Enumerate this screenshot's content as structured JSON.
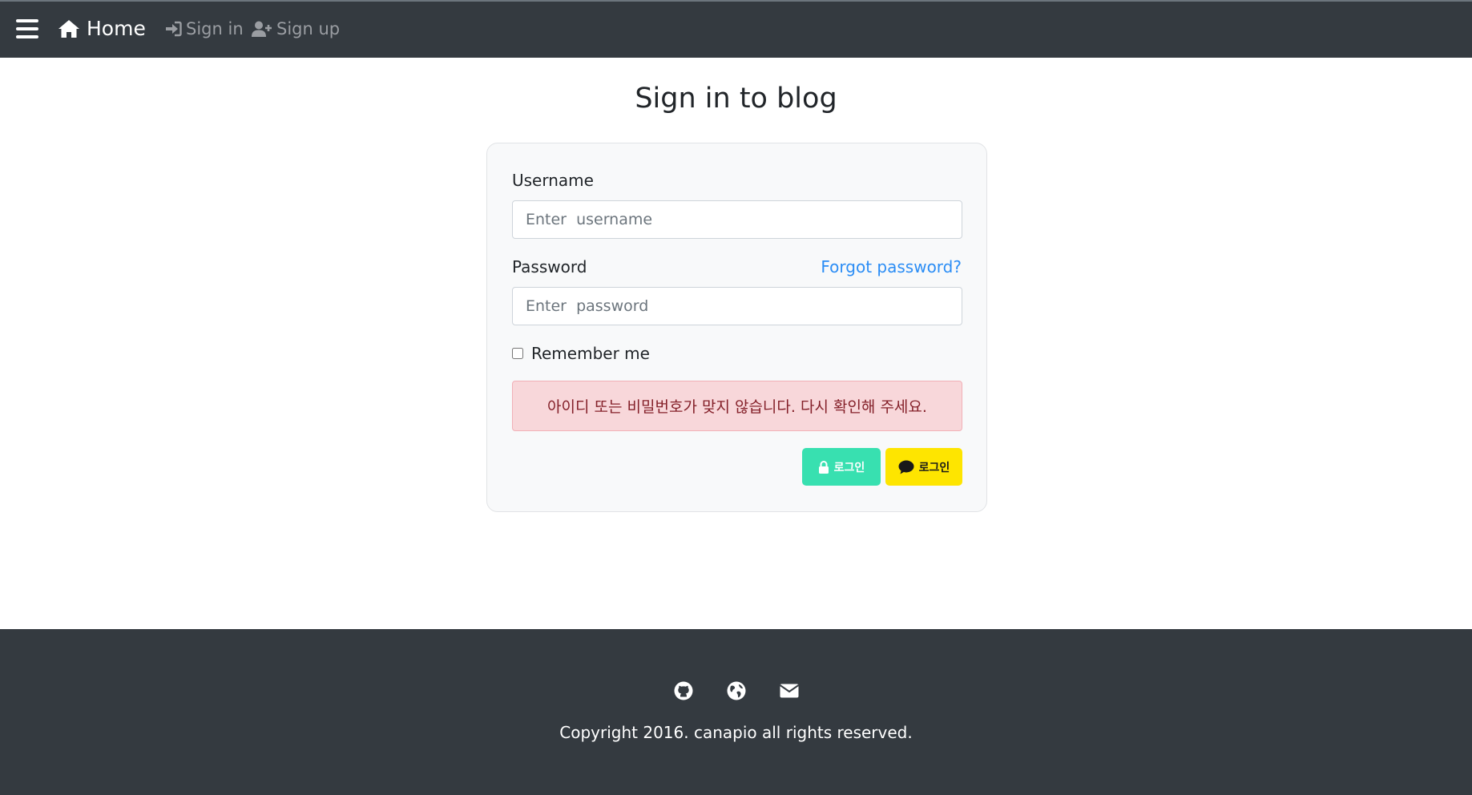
{
  "navbar": {
    "brand_label": "Home",
    "signin_label": "Sign in",
    "signup_label": "Sign up"
  },
  "page": {
    "title": "Sign in to blog"
  },
  "form": {
    "username_label": "Username",
    "username_placeholder": "Enter  username",
    "password_label": "Password",
    "password_placeholder": "Enter  password",
    "forgot_label": "Forgot password?",
    "remember_label": "Remember me",
    "remember_checked": false,
    "error_message": "아이디 또는 비밀번호가 맞지 않습니다. 다시 확인해 주세요.",
    "login_button_label": "로그인",
    "kakao_login_button_label": "로그인"
  },
  "footer": {
    "icons": [
      "github-icon",
      "globe-icon",
      "envelope-icon"
    ],
    "copyright": "Copyright 2016. canapio all rights reserved."
  },
  "colors": {
    "navbar_bg": "#343a40",
    "link": "#2b8df5",
    "alert_bg": "#f8d7da",
    "alert_text": "#842029",
    "login_button": "#38e0b0",
    "kakao_button": "#fee500"
  }
}
